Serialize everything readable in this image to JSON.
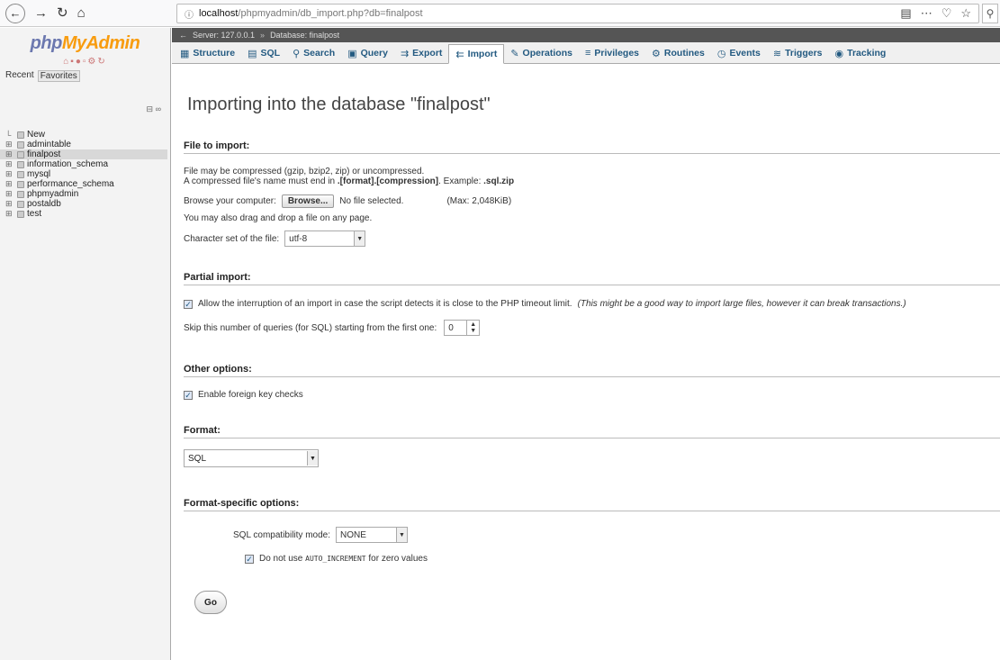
{
  "browser": {
    "url_host": "localhost",
    "url_path": "/phpmyadmin/db_import.php?db=finalpost"
  },
  "sidebar": {
    "logo_php": "php",
    "logo_myadmin": "MyAdmin",
    "recent": "Recent",
    "favorites": "Favorites",
    "tree": [
      {
        "label": "New",
        "active": false
      },
      {
        "label": "admintable",
        "active": false
      },
      {
        "label": "finalpost",
        "active": true
      },
      {
        "label": "information_schema",
        "active": false
      },
      {
        "label": "mysql",
        "active": false
      },
      {
        "label": "performance_schema",
        "active": false
      },
      {
        "label": "phpmyadmin",
        "active": false
      },
      {
        "label": "postaldb",
        "active": false
      },
      {
        "label": "test",
        "active": false
      }
    ]
  },
  "breadcrumb": {
    "server": "Server: 127.0.0.1",
    "database": "Database: finalpost"
  },
  "tabs": [
    {
      "label": "Structure",
      "icon": "structure-icon",
      "glyph": "▦"
    },
    {
      "label": "SQL",
      "icon": "sql-icon",
      "glyph": "▤"
    },
    {
      "label": "Search",
      "icon": "search-icon",
      "glyph": "⚲"
    },
    {
      "label": "Query",
      "icon": "query-icon",
      "glyph": "▣"
    },
    {
      "label": "Export",
      "icon": "export-icon",
      "glyph": "⇉"
    },
    {
      "label": "Import",
      "icon": "import-icon",
      "glyph": "⇇",
      "active": true
    },
    {
      "label": "Operations",
      "icon": "wrench-icon",
      "glyph": "✎"
    },
    {
      "label": "Privileges",
      "icon": "privileges-icon",
      "glyph": "≡"
    },
    {
      "label": "Routines",
      "icon": "routines-icon",
      "glyph": "⚙"
    },
    {
      "label": "Events",
      "icon": "clock-icon",
      "glyph": "◷"
    },
    {
      "label": "Triggers",
      "icon": "triggers-icon",
      "glyph": "≋"
    },
    {
      "label": "Tracking",
      "icon": "eye-icon",
      "glyph": "◉"
    }
  ],
  "page_title": "Importing into the database \"finalpost\"",
  "file_to_import": {
    "heading": "File to import:",
    "line1": "File may be compressed (gzip, bzip2, zip) or uncompressed.",
    "line2_a": "A compressed file's name must end in ",
    "line2_b": ".[format].[compression]",
    "line2_c": ". Example: ",
    "line2_d": ".sql.zip",
    "browse_label": "Browse your computer:",
    "browse_button": "Browse...",
    "no_file": "No file selected.",
    "max": "(Max: 2,048KiB)",
    "drag_drop": "You may also drag and drop a file on any page.",
    "charset_label": "Character set of the file:",
    "charset_value": "utf-8"
  },
  "partial_import": {
    "heading": "Partial import:",
    "allow_interrupt": "Allow the interruption of an import in case the script detects it is close to the PHP timeout limit.",
    "allow_interrupt_note": "(This might be a good way to import large files, however it can break transactions.)",
    "skip_label": "Skip this number of queries (for SQL) starting from the first one:",
    "skip_value": "0"
  },
  "other_options": {
    "heading": "Other options:",
    "foreign_keys": "Enable foreign key checks"
  },
  "format": {
    "heading": "Format:",
    "value": "SQL"
  },
  "format_specific": {
    "heading": "Format-specific options:",
    "compat_label": "SQL compatibility mode:",
    "compat_value": "NONE",
    "no_auto_a": "Do not use ",
    "no_auto_code": "AUTO_INCREMENT",
    "no_auto_b": " for zero values"
  },
  "go_button": "Go"
}
